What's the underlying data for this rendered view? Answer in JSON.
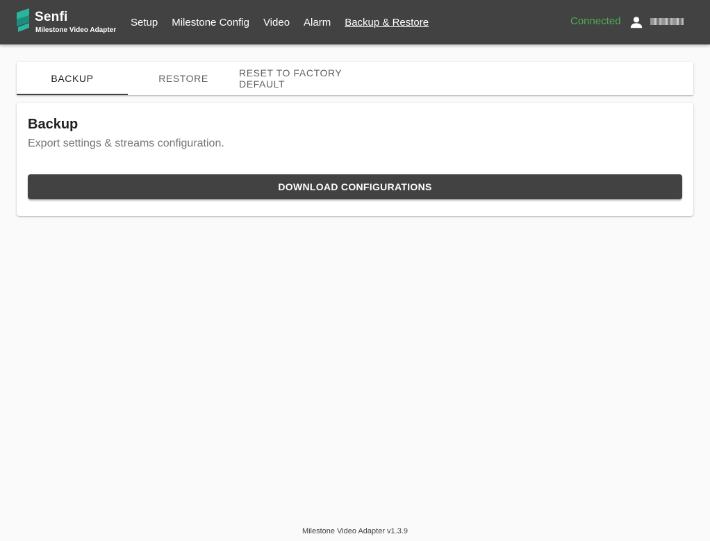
{
  "app": {
    "brand_name": "Senfi",
    "brand_subtitle": "Milestone Video Adapter",
    "brand_colors": {
      "logo_teal": "#2bb5a0",
      "logo_dark_teal": "#1a8f7e"
    }
  },
  "nav": {
    "items": [
      {
        "label": "Setup"
      },
      {
        "label": "Milestone Config"
      },
      {
        "label": "Video"
      },
      {
        "label": "Alarm"
      },
      {
        "label": "Backup & Restore",
        "active": true
      }
    ]
  },
  "status": {
    "label": "Connected",
    "color": "#4caf50"
  },
  "user": {
    "icon": "person-icon",
    "name_redacted": true
  },
  "tabs": [
    {
      "label": "BACKUP",
      "active": true
    },
    {
      "label": "RESTORE"
    },
    {
      "label": "RESET TO FACTORY DEFAULT"
    }
  ],
  "backup_panel": {
    "title": "Backup",
    "subtitle": "Export settings & streams configuration.",
    "download_label": "DOWNLOAD CONFIGURATIONS"
  },
  "footer": {
    "version_text": "Milestone Video Adapter v1.3.9"
  },
  "colors": {
    "topbar": "#424242",
    "page_background": "#fafafa",
    "primary_button": "#424242"
  }
}
